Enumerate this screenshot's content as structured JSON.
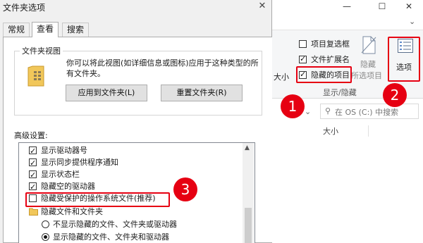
{
  "dialog": {
    "title": "文件夹选项",
    "close_glyph": "✕",
    "tabs": [
      {
        "label": "常规"
      },
      {
        "label": "查看"
      },
      {
        "label": "搜索"
      }
    ],
    "folder_view": {
      "legend": "文件夹视图",
      "desc_line1": "你可以将此视图(如详细信息或图标)应用于这种类型的所",
      "desc_line2": "有文件夹。",
      "apply_button": "应用到文件夹(L)",
      "reset_button": "重置文件夹(R)"
    },
    "advanced_label": "高级设置:",
    "tree_items": [
      {
        "label": "显示驱动器号",
        "checked": true
      },
      {
        "label": "显示同步提供程序通知",
        "checked": true
      },
      {
        "label": "显示状态栏",
        "checked": true
      },
      {
        "label": "隐藏空的驱动器",
        "checked": true
      },
      {
        "label": "隐藏受保护的操作系统文件(推荐)",
        "checked": false
      },
      {
        "label": "隐藏文件和文件夹"
      },
      {
        "label": "不显示隐藏的文件、文件夹或驱动器",
        "selected": false
      },
      {
        "label": "显示隐藏的文件、文件夹和驱动器",
        "selected": true
      }
    ]
  },
  "explorer": {
    "window_controls": {
      "minimize": "—",
      "maximize": "☐",
      "close": "✕"
    },
    "ribbon": {
      "size_label": "大小",
      "item_checkboxes_label": "项目复选框",
      "item_checkboxes_checked": false,
      "file_extensions_label": "文件扩展名",
      "file_extensions_checked": true,
      "hidden_items_label": "隐藏的项目",
      "hidden_items_checked": true,
      "hide_label": "隐藏",
      "hide_selected_label": "所选项目",
      "group_label": "显示/隐藏",
      "options_label": "选项"
    },
    "search_placeholder": "在 OS (C:) 中搜索",
    "column_header": "大小",
    "expand_glyph": "⌄"
  },
  "annotations": {
    "step1": "1",
    "step2": "2",
    "step3": "3",
    "accent": "#e60012"
  }
}
